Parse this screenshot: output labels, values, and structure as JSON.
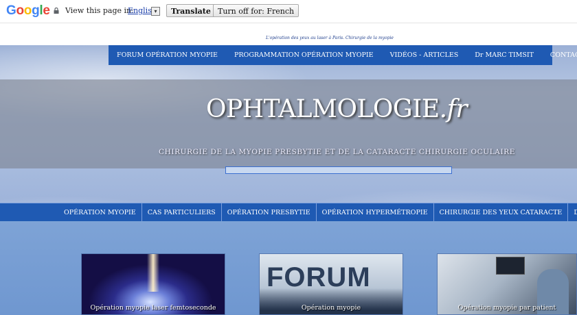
{
  "translate_bar": {
    "logo": [
      "G",
      "o",
      "o",
      "g",
      "l",
      "e"
    ],
    "logo_colors": [
      "#4285F4",
      "#EA4335",
      "#FBBC05",
      "#4285F4",
      "#34A853",
      "#EA4335"
    ],
    "view_label": "View this page in:",
    "language": "English",
    "dropdown_symbol": "▾",
    "translate_button": "Translate",
    "turn_off_button": "Turn off for: French"
  },
  "tagline": "L'opération des yeux au laser à Paris. Chirurgie de la myopie",
  "top_nav": [
    "FORUM OPÉRATION MYOPIE",
    "PROGRAMMATION OPÉRATION MYOPIE",
    "VIDÉOS - ARTICLES",
    "Dr MARC TIMSIT",
    "CONTACT"
  ],
  "site": {
    "title_main": "OPHTALMOLOGIE",
    "title_ext": ".fr",
    "subtitle": "CHIRURGIE DE LA MYOPIE PRESBYTIE ET DE LA CATARACTE CHIRURGIE OCULAIRE"
  },
  "main_nav": [
    "OPÉRATION MYOPIE",
    "CAS PARTICULIERS",
    "OPÉRATION PRESBYTIE",
    "OPÉRATION HYPERMÉTROPIE",
    "CHIRURGIE DES YEUX CATARACTE",
    "DÉFAUTS DE LA"
  ],
  "cards": [
    {
      "caption": "Opération myopie laser femtoseconde"
    },
    {
      "caption": "Opération myopie",
      "image_word": "FORUM"
    },
    {
      "caption": "Opération myopie par patient"
    }
  ],
  "colors": {
    "nav_blue": "#1f5ab3",
    "content_blue": "#7ea3d6"
  }
}
